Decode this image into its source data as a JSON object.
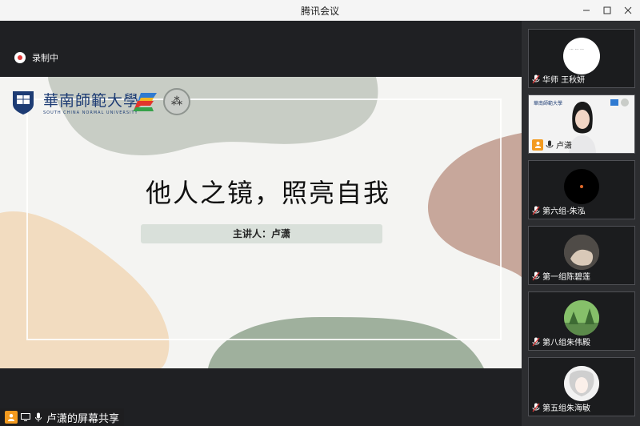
{
  "window": {
    "title": "腾讯会议",
    "controls": [
      "minimize",
      "maximize",
      "close"
    ]
  },
  "recording": {
    "label": "录制中"
  },
  "slide": {
    "university": "華南師範大學",
    "university_en": "SOUTH CHINA NORMAL UNIVERSITY",
    "title": "他人之镜，照亮自我",
    "speaker": "主讲人：卢潇"
  },
  "share_bar": {
    "label": "卢潇的屏幕共享"
  },
  "participants": [
    {
      "name": "华师 王秋妍",
      "avatar": "white-circle"
    },
    {
      "name": "卢潇",
      "avatar": "video"
    },
    {
      "name": "第六组-朱泓",
      "avatar": "dark-circle"
    },
    {
      "name": "第一组陈碧莲",
      "avatar": "photo-hand"
    },
    {
      "name": "第八组朱伟殿",
      "avatar": "photo-landscape"
    },
    {
      "name": "第五组朱海敏",
      "avatar": "photo-anime"
    }
  ],
  "colors": {
    "accent_orange": "#f39a1e",
    "record_red": "#e23b3b",
    "slide_sage": "#8fa58e",
    "slide_peach": "#f2dcc0",
    "slide_mauve": "#c7a79b"
  }
}
